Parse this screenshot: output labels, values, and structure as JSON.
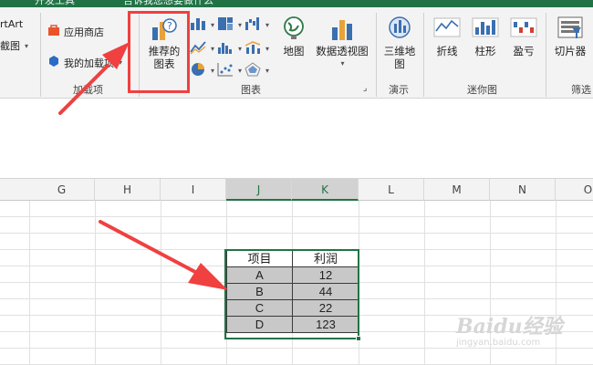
{
  "window": {
    "title_fragment_left": "开发工具",
    "title_fragment_right": "告诉我您想要做什么"
  },
  "ribbon": {
    "smartart_label": "rtArt",
    "screenshot_label": "截图",
    "app_store_label": "应用商店",
    "my_addins_label": "我的加载项",
    "addins_group_label": "加载项",
    "recommended_charts_line1": "推荐的",
    "recommended_charts_line2": "图表",
    "charts_group_label": "图表",
    "map_label": "地图",
    "pivot_chart_label": "数据透视图",
    "3d_map_line1": "三维地",
    "3d_map_line2": "图",
    "tours_group_label": "演示",
    "line_spark_label": "折线",
    "column_spark_label": "柱形",
    "winloss_spark_label": "盈亏",
    "sparklines_group_label": "迷你图",
    "slicer_label": "切片器",
    "filter_group_label": "筛选"
  },
  "columns": [
    "G",
    "H",
    "I",
    "J",
    "K",
    "L",
    "M",
    "N",
    "O"
  ],
  "table": {
    "headers": [
      "项目",
      "利润"
    ],
    "rows": [
      [
        "A",
        "12"
      ],
      [
        "B",
        "44"
      ],
      [
        "C",
        "22"
      ],
      [
        "D",
        "123"
      ]
    ]
  },
  "watermark": {
    "line1": "Baidu经验",
    "line2": "jingyan.baidu.com"
  },
  "colors": {
    "excel_green": "#217346",
    "annotation_red": "#f04040",
    "table_fill": "#c8c8c8"
  }
}
